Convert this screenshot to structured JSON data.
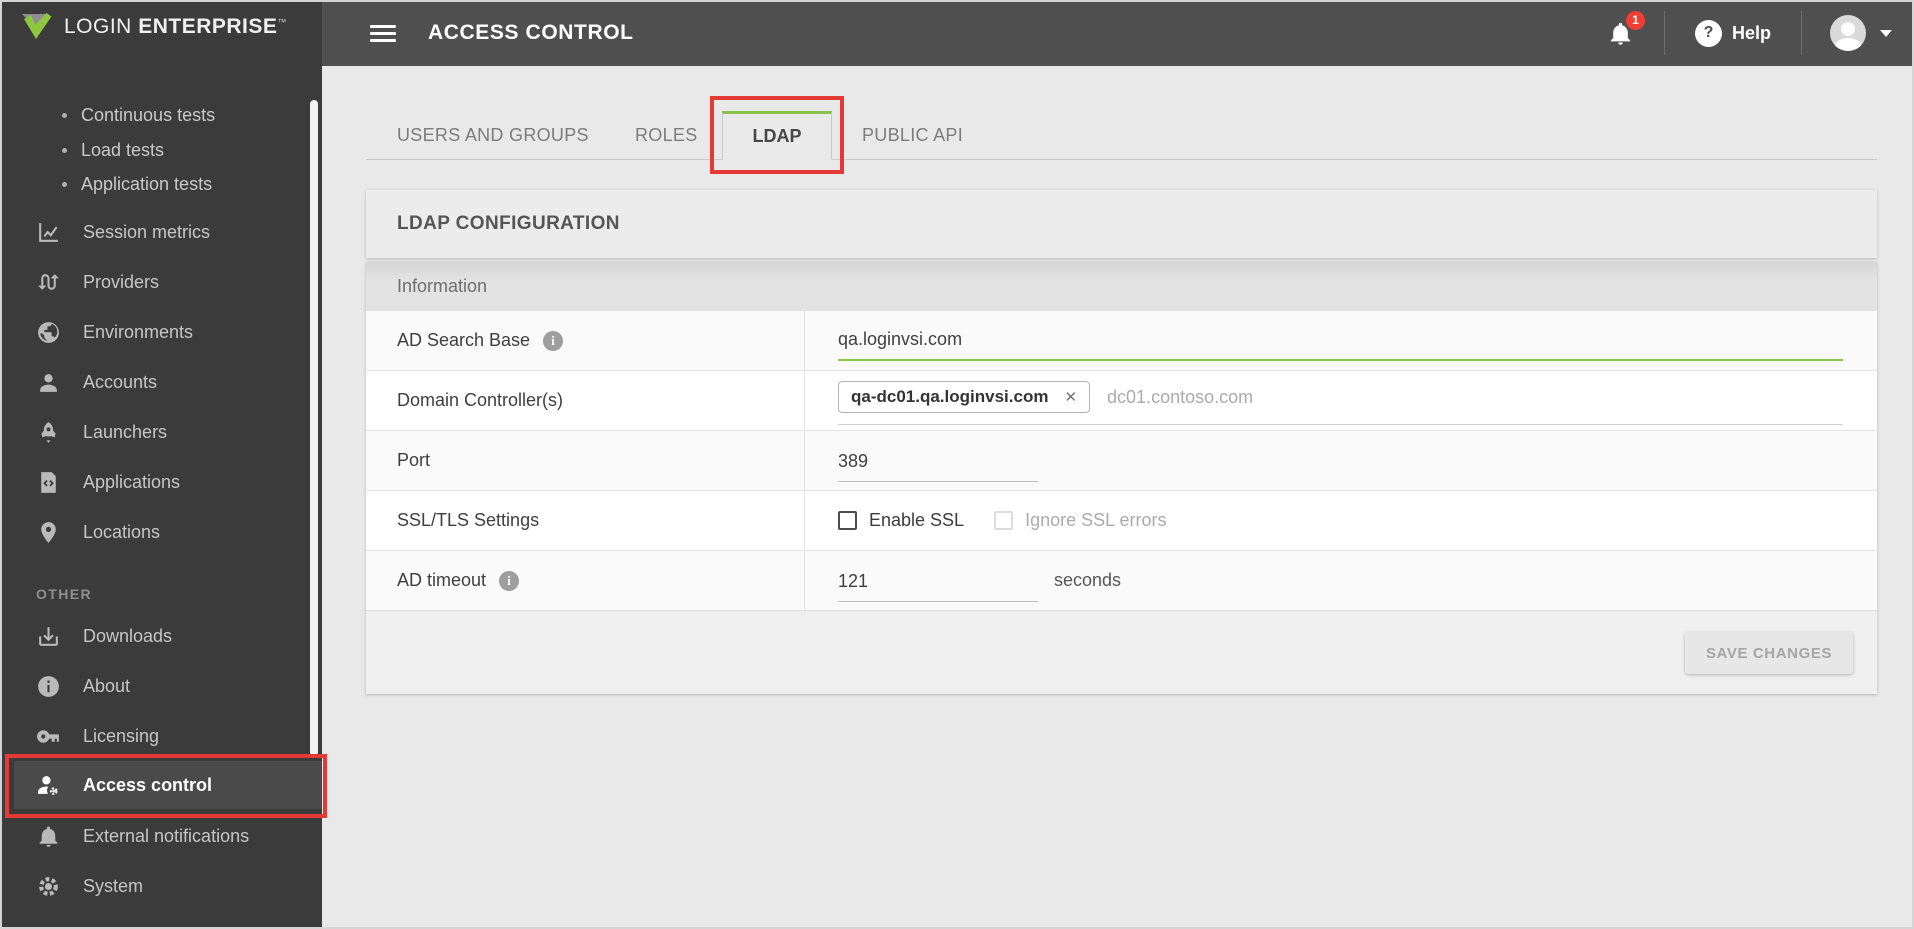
{
  "topbar": {
    "title": "ACCESS CONTROL",
    "notification_count": "1",
    "help_glyph": "?",
    "help_label": "Help"
  },
  "sidebar": {
    "logo": {
      "word1": "LOGIN",
      "word2": "ENTERPRISE",
      "tm": "™"
    },
    "test_links": [
      {
        "label": "Continuous tests"
      },
      {
        "label": "Load tests"
      },
      {
        "label": "Application tests"
      }
    ],
    "items": [
      {
        "label": "Session metrics",
        "icon": "chart-line-icon"
      },
      {
        "label": "Providers",
        "icon": "swap-icon"
      },
      {
        "label": "Environments",
        "icon": "globe-icon"
      },
      {
        "label": "Accounts",
        "icon": "person-icon"
      },
      {
        "label": "Launchers",
        "icon": "rocket-icon"
      },
      {
        "label": "Applications",
        "icon": "code-file-icon"
      },
      {
        "label": "Locations",
        "icon": "map-pin-icon"
      }
    ],
    "other_heading": "OTHER",
    "other_items": [
      {
        "label": "Downloads",
        "icon": "download-icon"
      },
      {
        "label": "About",
        "icon": "info-icon"
      },
      {
        "label": "Licensing",
        "icon": "key-icon"
      },
      {
        "label": "Access control",
        "icon": "person-gear-icon",
        "active": true
      },
      {
        "label": "External notifications",
        "icon": "bell-icon"
      },
      {
        "label": "System",
        "icon": "gear-icon"
      }
    ]
  },
  "tabs": [
    {
      "label": "USERS AND GROUPS",
      "active": false
    },
    {
      "label": "ROLES",
      "active": false
    },
    {
      "label": "LDAP",
      "active": true
    },
    {
      "label": "PUBLIC API",
      "active": false
    }
  ],
  "ldap_panel": {
    "title": "LDAP CONFIGURATION",
    "section_heading": "Information",
    "info_glyph": "i",
    "ad_search_base": {
      "label": "AD Search Base",
      "value": "qa.loginvsi.com"
    },
    "domain_controllers": {
      "label": "Domain Controller(s)",
      "chip": "qa-dc01.qa.loginvsi.com",
      "remove_glyph": "✕",
      "placeholder": "dc01.contoso.com"
    },
    "port": {
      "label": "Port",
      "value": "389"
    },
    "ssl": {
      "label": "SSL/TLS Settings",
      "enable_label": "Enable SSL",
      "enable_checked": false,
      "ignore_label": "Ignore SSL errors",
      "ignore_checked": false
    },
    "ad_timeout": {
      "label": "AD timeout",
      "value": "121",
      "unit": "seconds"
    },
    "save_label": "SAVE CHANGES"
  },
  "colors": {
    "accent_green": "#8bc34a",
    "annotation_red": "#e53935",
    "badge_red": "#f23d33",
    "sidebar_bg": "#3b3b3b",
    "topbar_bg": "#4f4f4f"
  }
}
